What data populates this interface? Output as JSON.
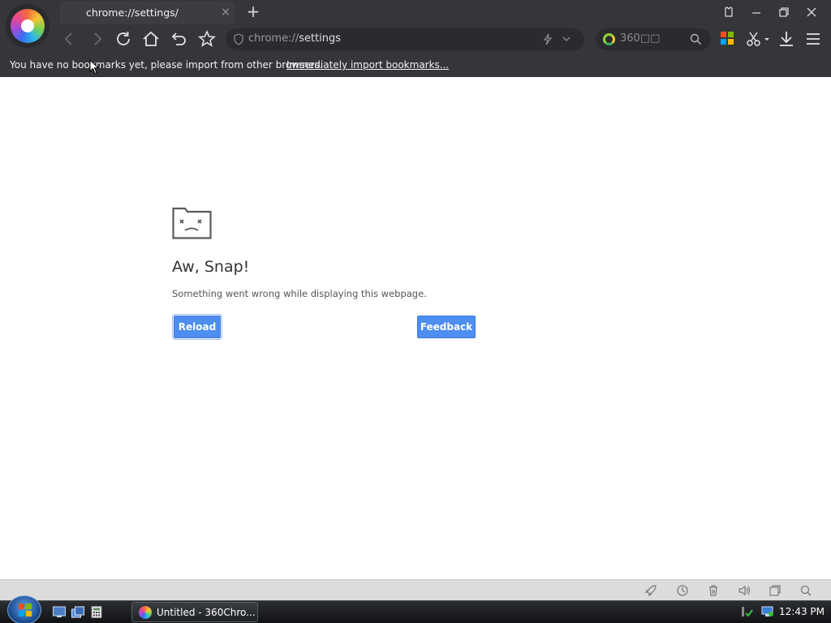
{
  "browser": {
    "tab": {
      "title": "chrome://settings/",
      "close_glyph": "×"
    },
    "new_tab_glyph": "+",
    "address": {
      "prefix": "chrome://",
      "host": "settings"
    },
    "search": {
      "placeholder": "360□□"
    },
    "bookmarks_bar": {
      "message": "You have no bookmarks yet, please import from other browsers.",
      "link": "Immediately import bookmarks..."
    }
  },
  "error_page": {
    "title": "Aw, Snap!",
    "message": "Something went wrong while displaying this webpage.",
    "reload_label": "Reload",
    "feedback_label": "Feedback"
  },
  "taskbar": {
    "window_label": "Untitled - 360Chro...",
    "clock": "12:43 PM"
  },
  "colors": {
    "chrome_bg": "#35363a",
    "button_blue": "#4d8ef0",
    "status_bar": "#dcdcdc"
  },
  "icons": {
    "toolbar": [
      "back-arrow-icon",
      "forward-arrow-icon",
      "reload-icon",
      "home-icon",
      "undo-icon",
      "star-icon"
    ],
    "right_tools": [
      "apps-grid-icon",
      "scissors-icon",
      "download-icon",
      "menu-icon"
    ],
    "status_bar": [
      "rocket-icon",
      "accelerate-icon",
      "trash-icon",
      "volume-icon",
      "window-icon",
      "search-icon"
    ]
  }
}
